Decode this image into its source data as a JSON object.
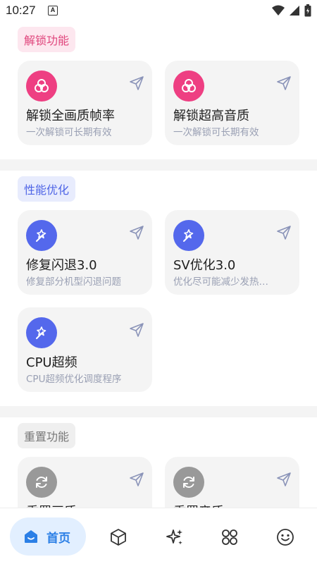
{
  "status_bar": {
    "time": "10:27",
    "badge": "A"
  },
  "sections": [
    {
      "tag": "解锁功能",
      "items": [
        {
          "title": "解锁全画质帧率",
          "subtitle": "一次解锁可长期有效"
        },
        {
          "title": "解锁超高音质",
          "subtitle": "一次解锁可长期有效"
        }
      ]
    },
    {
      "tag": "性能优化",
      "items": [
        {
          "title": "修复闪退3.0",
          "subtitle": "修复部分机型闪退问题"
        },
        {
          "title": "SV优化3.0",
          "subtitle": "优化尽可能减少发热…"
        },
        {
          "title": "CPU超频",
          "subtitle": "CPU超频优化调度程序"
        }
      ]
    },
    {
      "tag": "重置功能",
      "items": [
        {
          "title": "重置画质",
          "subtitle": ""
        },
        {
          "title": "重置音质",
          "subtitle": ""
        }
      ]
    }
  ],
  "bottom_nav": {
    "home_label": "首页"
  },
  "colors": {
    "pink": "#ee3f82",
    "blue": "#5468ec",
    "gray": "#999999",
    "nav_accent": "#2b7fe6"
  }
}
